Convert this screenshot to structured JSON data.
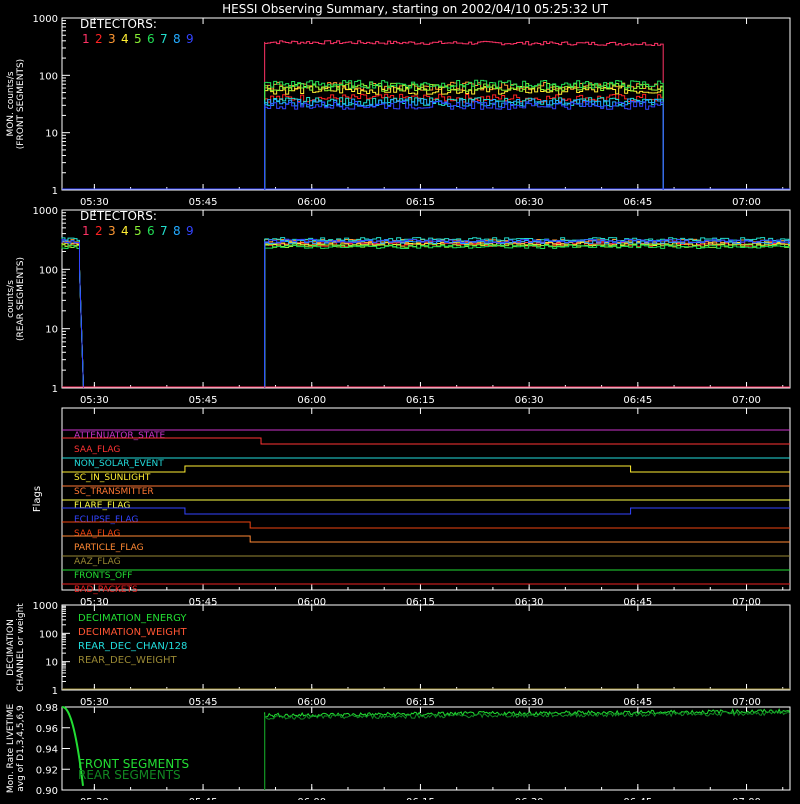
{
  "title": "HESSI Observing Summary, starting on 2002/04/10 05:25:32 UT",
  "colors": {
    "axes": "#ffffff",
    "background": "#000000",
    "detectors": [
      "#ff3366",
      "#ff2222",
      "#ff9933",
      "#ffee33",
      "#88ee33",
      "#22dd55",
      "#22ddcc",
      "#22aaff",
      "#3344ff"
    ]
  },
  "time_ticks": [
    "05:30",
    "05:45",
    "06:00",
    "06:15",
    "06:30",
    "06:45",
    "07:00"
  ],
  "chart_data": [
    {
      "type": "line",
      "panel": "front",
      "ylabel": "MON. counts/s (FRONT SEGMENTS)",
      "ylabel_lines": [
        "MON. counts/s",
        "(FRONT SEGMENTS)"
      ],
      "yscale": "log",
      "ylim": [
        1,
        1000
      ],
      "xlim": [
        "05:25:32",
        "07:06:00"
      ],
      "ytick_labels": [
        "1000",
        "100",
        "10",
        "1"
      ],
      "legend_title": "DETECTORS:",
      "legend_labels": [
        "1",
        "2",
        "3",
        "4",
        "5",
        "6",
        "7",
        "8",
        "9"
      ],
      "data_window": [
        "05:53:30",
        "06:48:30"
      ],
      "series": [
        {
          "name": "1",
          "value": 380
        },
        {
          "name": "2",
          "value": 40
        },
        {
          "name": "3",
          "value": 65
        },
        {
          "name": "4",
          "value": 55
        },
        {
          "name": "5",
          "value": 62
        },
        {
          "name": "6",
          "value": 70
        },
        {
          "name": "7",
          "value": 35
        },
        {
          "name": "8",
          "value": 33
        },
        {
          "name": "9",
          "value": 30
        }
      ]
    },
    {
      "type": "line",
      "panel": "rear",
      "ylabel": "counts/s (REAR SEGMENTS)",
      "ylabel_lines": [
        "counts/s",
        "(REAR SEGMENTS)"
      ],
      "yscale": "log",
      "ylim": [
        1,
        1000
      ],
      "xlim": [
        "05:25:32",
        "07:06:00"
      ],
      "ytick_labels": [
        "1000",
        "100",
        "10",
        "1"
      ],
      "legend_title": "DETECTORS:",
      "legend_labels": [
        "1",
        "2",
        "3",
        "4",
        "5",
        "6",
        "7",
        "8",
        "9"
      ],
      "early_window": [
        "05:25:32",
        "05:28:30"
      ],
      "data_window": [
        "05:53:30",
        "07:06:00"
      ],
      "series": [
        {
          "name": "1",
          "value": 280
        },
        {
          "name": "2",
          "value": 260
        },
        {
          "name": "3",
          "value": 300
        },
        {
          "name": "4",
          "value": 270
        },
        {
          "name": "5",
          "value": 250
        },
        {
          "name": "6",
          "value": 240
        },
        {
          "name": "7",
          "value": 320
        },
        {
          "name": "8",
          "value": 290
        },
        {
          "name": "9",
          "value": 300
        }
      ]
    },
    {
      "type": "line",
      "panel": "flags",
      "ylabel": "Flags",
      "xlim": [
        "05:25:32",
        "07:06:00"
      ],
      "flags": [
        {
          "name": "ATTENUATOR_STATE",
          "color": "#cc33cc",
          "segments": [
            [
              "05:25:32",
              "07:06:00",
              0
            ]
          ]
        },
        {
          "name": "SAA_FLAG",
          "color": "#ff3333",
          "segments": [
            [
              "05:25:32",
              "05:53:00",
              1
            ],
            [
              "05:53:00",
              "07:06:00",
              0
            ]
          ]
        },
        {
          "name": "NON_SOLAR_EVENT",
          "color": "#22dddd",
          "segments": [
            [
              "05:25:32",
              "07:06:00",
              0
            ]
          ]
        },
        {
          "name": "SC_IN_SUNLIGHT",
          "color": "#ffee33",
          "segments": [
            [
              "05:25:32",
              "05:42:30",
              0
            ],
            [
              "05:42:30",
              "06:44:00",
              1
            ],
            [
              "06:44:00",
              "07:06:00",
              0
            ]
          ]
        },
        {
          "name": "SC_TRANSMITTER",
          "color": "#ff7733",
          "segments": [
            [
              "05:25:32",
              "07:06:00",
              0
            ]
          ]
        },
        {
          "name": "FLARE_FLAG",
          "color": "#ffff44",
          "segments": [
            [
              "05:25:32",
              "07:06:00",
              0
            ]
          ]
        },
        {
          "name": "ECLIPSE_FLAG",
          "color": "#3344ff",
          "segments": [
            [
              "05:25:32",
              "05:42:30",
              1
            ],
            [
              "05:42:30",
              "06:44:00",
              0
            ],
            [
              "06:44:00",
              "07:06:00",
              1
            ]
          ]
        },
        {
          "name": "SAA_FLAG",
          "color": "#ee4411",
          "segments": [
            [
              "05:25:32",
              "05:51:30",
              1
            ],
            [
              "05:51:30",
              "07:06:00",
              0
            ]
          ]
        },
        {
          "name": "PARTICLE_FLAG",
          "color": "#ff8833",
          "segments": [
            [
              "05:25:32",
              "05:51:30",
              1
            ],
            [
              "05:51:30",
              "07:06:00",
              0
            ]
          ]
        },
        {
          "name": "AAZ_FLAG",
          "color": "#998833",
          "segments": [
            [
              "05:25:32",
              "07:06:00",
              0
            ]
          ]
        },
        {
          "name": "FRONTS_OFF",
          "color": "#22dd33",
          "segments": [
            [
              "05:25:32",
              "07:06:00",
              0
            ]
          ]
        },
        {
          "name": "BAD_PACKETS",
          "color": "#ee2222",
          "segments": [
            [
              "05:25:32",
              "07:06:00",
              0
            ]
          ]
        }
      ]
    },
    {
      "type": "line",
      "panel": "decimation",
      "ylabel": "DECIMATION CHANNEL or weight",
      "ylabel_lines": [
        "DECIMATION",
        "CHANNEL or weight"
      ],
      "yscale": "log",
      "ylim": [
        1,
        1000
      ],
      "xlim": [
        "05:25:32",
        "07:06:00"
      ],
      "ytick_labels": [
        "1000",
        "100",
        "10",
        "1"
      ],
      "series": [
        {
          "name": "DECIMATION_ENERGY",
          "color": "#22dd33",
          "value": 1
        },
        {
          "name": "DECIMATION_WEIGHT",
          "color": "#ff5533",
          "value": 1
        },
        {
          "name": "REAR_DEC_CHAN/128",
          "color": "#22dddd",
          "value": 1
        },
        {
          "name": "REAR_DEC_WEIGHT",
          "color": "#998833",
          "value": 1
        }
      ]
    },
    {
      "type": "line",
      "panel": "livetime",
      "ylabel": "Mon. Rate LIVETIME avg of D1,3,4,5,6,9",
      "ylabel_lines": [
        "Mon. Rate LIVETIME",
        "avg of D1,3,4,5,6,9"
      ],
      "ylim": [
        0.9,
        0.98
      ],
      "xlim": [
        "05:25:32",
        "07:06:00"
      ],
      "ytick_labels": [
        "0.98",
        "0.96",
        "0.94",
        "0.92",
        "0.90"
      ],
      "series": [
        {
          "name": "FRONT SEGMENTS",
          "color": "#22dd33",
          "start": "05:53:30",
          "value": 0.975
        },
        {
          "name": "REAR SEGMENTS",
          "color": "#118822",
          "start": "05:53:30",
          "value": 0.973
        }
      ],
      "early_decay": {
        "start": "05:25:32",
        "end": "05:28:30",
        "from": 0.98,
        "to": 0.9
      }
    }
  ]
}
